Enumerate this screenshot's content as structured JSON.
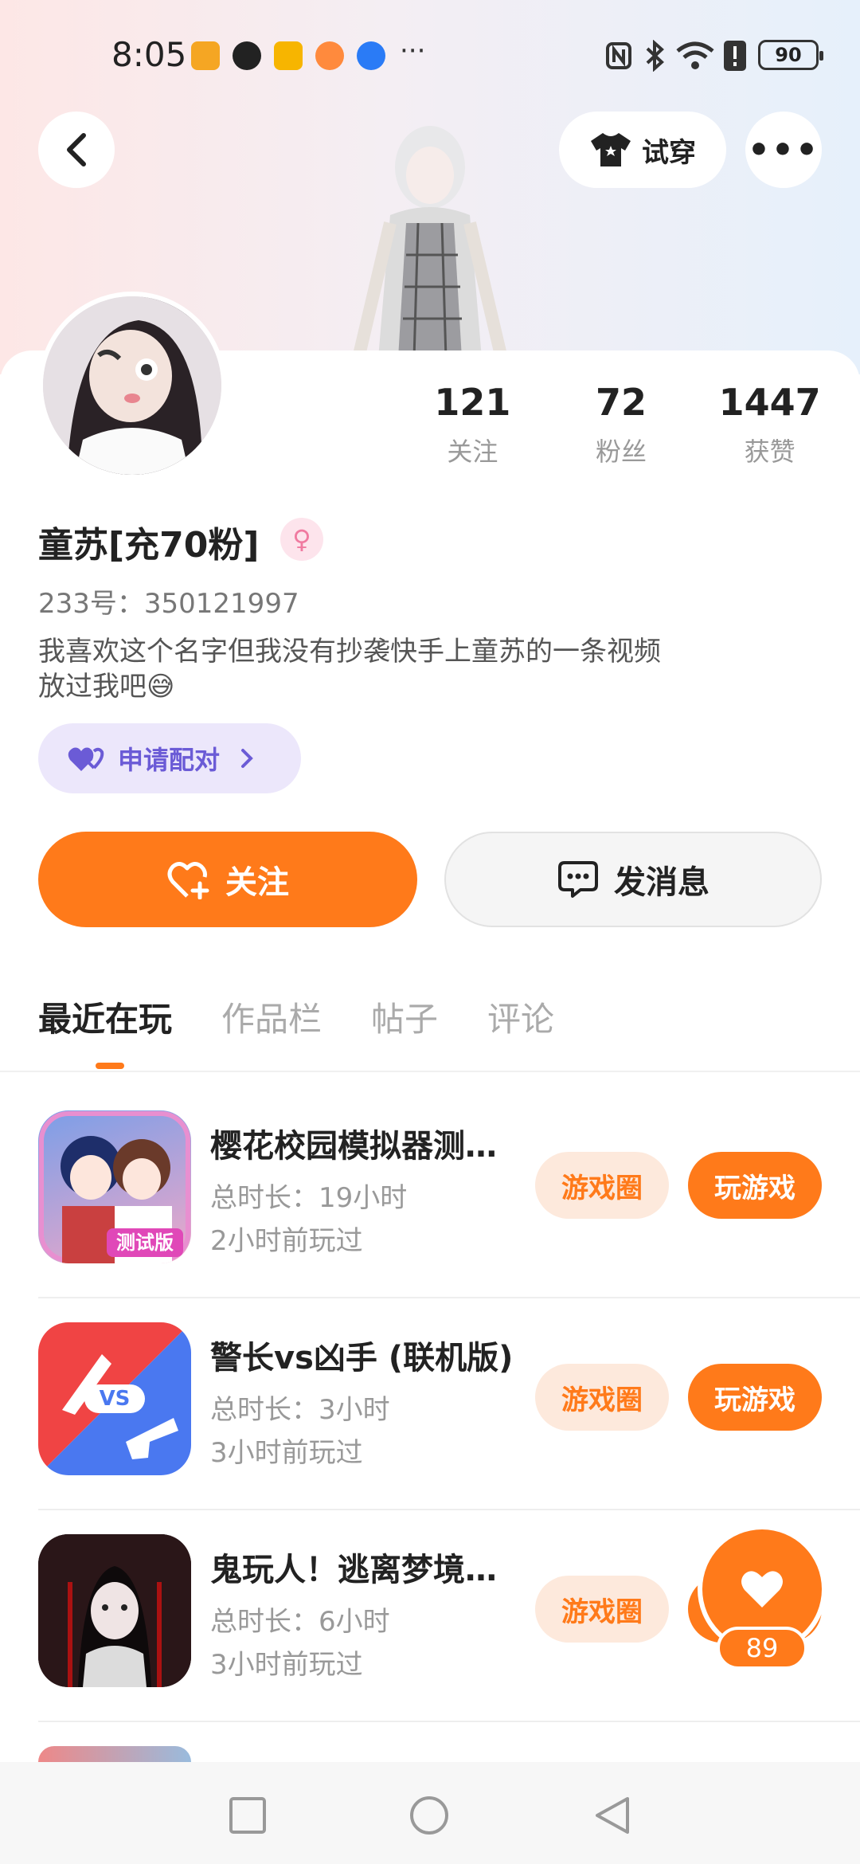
{
  "status_bar": {
    "time": "8:05",
    "more": "···",
    "battery": "90"
  },
  "header": {
    "try_on_label": "试穿",
    "more_label": "•••"
  },
  "profile": {
    "stats": [
      {
        "num": "121",
        "label": "关注"
      },
      {
        "num": "72",
        "label": "粉丝"
      },
      {
        "num": "1447",
        "label": "获赞"
      }
    ],
    "name": "童苏[充70粉]",
    "uid": "233号：350121997",
    "bio_line1": "我喜欢这个名字但我没有抄袭快手上童苏的一条视频",
    "bio_line2": "放过我吧😅",
    "pair_label": "申请配对"
  },
  "actions": {
    "follow_label": "关注",
    "message_label": "发消息"
  },
  "tabs": [
    "最近在玩",
    "作品栏",
    "帖子",
    "评论"
  ],
  "games": [
    {
      "title": "樱花校园模拟器测…",
      "duration": "总时长：19小时",
      "last_played": "2小时前玩过",
      "circle_label": "游戏圈",
      "play_label": "玩游戏",
      "icon_text": "测试版"
    },
    {
      "title": "警长vs凶手 (联机版)",
      "duration": "总时长：3小时",
      "last_played": "3小时前玩过",
      "circle_label": "游戏圈",
      "play_label": "玩游戏",
      "icon_text": "VS"
    },
    {
      "title": "鬼玩人！逃离梦境…",
      "duration": "总时长：6小时",
      "last_played": "3小时前玩过",
      "circle_label": "游戏圈",
      "play_label": ""
    }
  ],
  "fab": {
    "count": "89"
  },
  "colors": {
    "accent": "#ff7a1a",
    "purple": "#6b5bd6"
  }
}
